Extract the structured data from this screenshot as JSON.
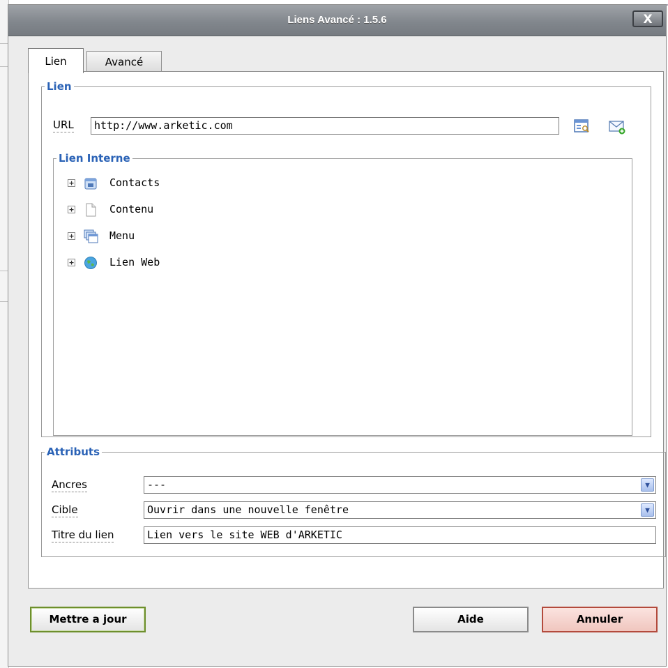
{
  "window": {
    "title": "Liens Avancé : 1.5.6",
    "close_label": "X"
  },
  "tabs": [
    {
      "label": "Lien",
      "active": true
    },
    {
      "label": "Avancé",
      "active": false
    }
  ],
  "lien_group": {
    "legend": "Lien",
    "url_label": "URL",
    "url_value": "http://www.arketic.com",
    "browse_icon": "file-browser-icon",
    "email_icon": "email-link-icon"
  },
  "internal_link": {
    "legend": "Lien Interne",
    "items": [
      {
        "label": "Contacts",
        "icon": "contacts-icon",
        "expander": "+"
      },
      {
        "label": "Contenu",
        "icon": "document-icon",
        "expander": "+"
      },
      {
        "label": "Menu",
        "icon": "menu-icon",
        "expander": "+"
      },
      {
        "label": "Lien Web",
        "icon": "globe-icon",
        "expander": "+"
      }
    ]
  },
  "attributes": {
    "legend": "Attributs",
    "anchors": {
      "label": "Ancres",
      "value": "---"
    },
    "target": {
      "label": "Cible",
      "value": "Ouvrir dans une nouvelle fenêtre"
    },
    "link_title": {
      "label": "Titre du lien",
      "value": "Lien vers le site WEB d'ARKETIC"
    }
  },
  "buttons": {
    "update": "Mettre a jour",
    "help": "Aide",
    "cancel": "Annuler"
  },
  "colors": {
    "legend_blue": "#2a62b6",
    "titlebar": "#82878d",
    "update_border": "#6d8f2c",
    "cancel_border": "#b34a3c"
  }
}
